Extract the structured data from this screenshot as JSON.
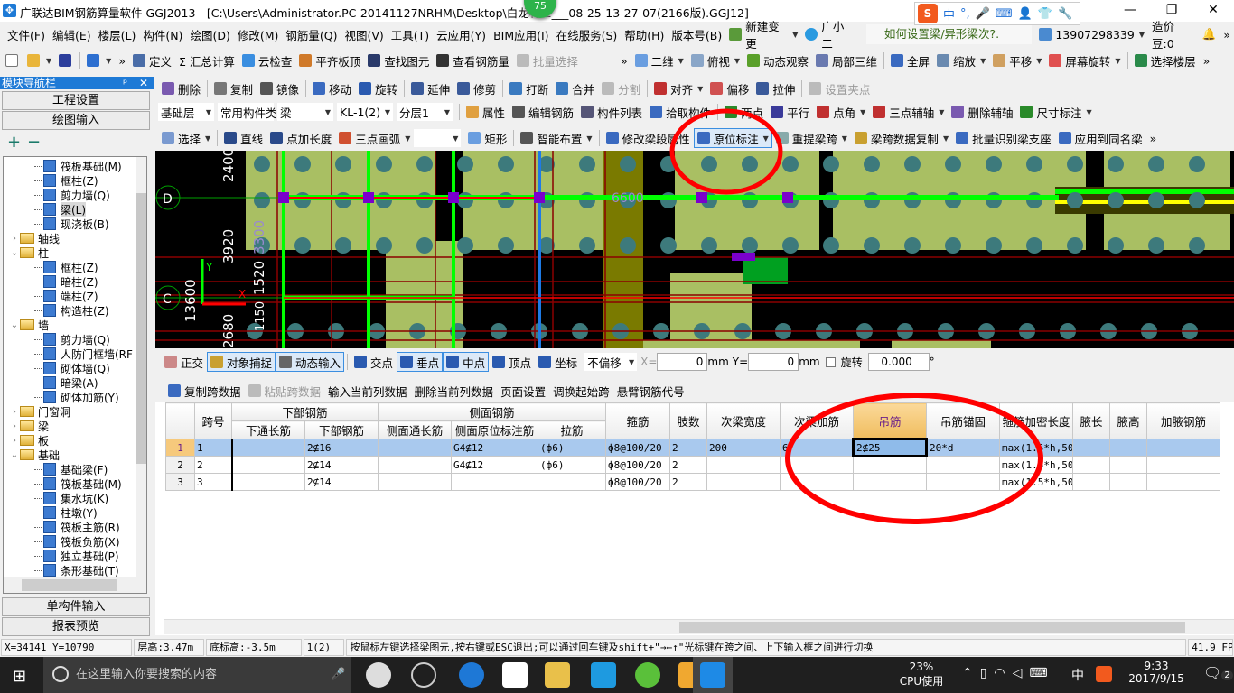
{
  "window": {
    "title": "广联达BIM钢筋算量软件 GGJ2013 - [C:\\Users\\Administrator.PC-20141127NRHM\\Desktop\\白龙村-2___08-25-13-27-07(2166版).GGJ12]",
    "badge": "75",
    "controls": [
      "—",
      "❐",
      "✕"
    ]
  },
  "ime": {
    "logo": "S",
    "items": [
      "中",
      "°,",
      "🎤",
      "⌨",
      "👤",
      "👕",
      "🔧"
    ]
  },
  "menu": {
    "items": [
      "文件(F)",
      "编辑(E)",
      "楼层(L)",
      "构件(N)",
      "绘图(D)",
      "修改(M)",
      "钢筋量(Q)",
      "视图(V)",
      "工具(T)",
      "云应用(Y)",
      "BIM应用(I)",
      "在线服务(S)",
      "帮助(H)",
      "版本号(B)"
    ],
    "new_change": "新建变更",
    "assistant": "广小二",
    "question": "如何设置梁/异形梁次?.",
    "account": "13907298339",
    "beans": "造价豆:0",
    "more": "»"
  },
  "toolbar_main_left": [
    {
      "icon": "new-file",
      "label": "",
      "c": "#fff"
    },
    {
      "icon": "open-folder",
      "label": "",
      "c": "#e9b53a",
      "dd": true
    },
    {
      "icon": "save",
      "label": "",
      "c": "#2c3e9c"
    },
    {
      "sep": true
    },
    {
      "icon": "undo",
      "label": "",
      "c": "#2d6fd0",
      "dd": true
    },
    {
      "label": "»"
    },
    {
      "icon": "define",
      "label": "定义",
      "c": "#4a6da8"
    },
    {
      "icon": "sigma",
      "label": "Σ 汇总计算",
      "noicon": true
    },
    {
      "icon": "cloud-check",
      "label": "云检查",
      "c": "#3a8ee0"
    },
    {
      "icon": "level-slab-top",
      "label": "平齐板顶",
      "c": "#d07a2a"
    },
    {
      "icon": "binoculars",
      "label": "查找图元",
      "c": "#2a3a6a"
    },
    {
      "icon": "glasses",
      "label": "查看钢筋量",
      "c": "#333"
    },
    {
      "icon": "batch-select",
      "label": "批量选择",
      "c": "#bbb",
      "dis": true
    }
  ],
  "toolbar_main_right": [
    {
      "label": "»"
    },
    {
      "icon": "2d-view",
      "label": "二维",
      "c": "#6a9ee0",
      "dd": true
    },
    {
      "icon": "top-view",
      "label": "俯视",
      "c": "#8aa6c8",
      "dd": true
    },
    {
      "icon": "orbit",
      "label": "动态观察",
      "c": "#5aa02a"
    },
    {
      "icon": "local-3d",
      "label": "局部三维",
      "c": "#6a7ab0"
    },
    {
      "sep": true
    },
    {
      "icon": "fullscreen",
      "label": "全屏",
      "c": "#3a6ac0"
    },
    {
      "icon": "zoom",
      "label": "缩放",
      "c": "#6a8ab0",
      "dd": true
    },
    {
      "icon": "pan",
      "label": "平移",
      "c": "#d0a060",
      "dd": true
    },
    {
      "icon": "screen-rotate",
      "label": "屏幕旋转",
      "c": "#e05050",
      "dd": true
    },
    {
      "sep": true
    },
    {
      "icon": "select-floor",
      "label": "选择楼层",
      "c": "#2a8a4a"
    },
    {
      "label": "»"
    }
  ],
  "toolbar_edit": [
    {
      "icon": "delete",
      "label": "删除",
      "c": "#7a5ab0"
    },
    {
      "sep": true
    },
    {
      "icon": "copy",
      "label": "复制",
      "c": "#777"
    },
    {
      "icon": "mirror",
      "label": "镜像",
      "c": "#555"
    },
    {
      "sep": true
    },
    {
      "icon": "move",
      "label": "移动",
      "c": "#3a6ac0"
    },
    {
      "icon": "rotate",
      "label": "旋转",
      "c": "#2a5ab0"
    },
    {
      "sep": true
    },
    {
      "icon": "extend",
      "label": "延伸",
      "c": "#3a5a9a"
    },
    {
      "icon": "trim",
      "label": "修剪",
      "c": "#3a5a9a"
    },
    {
      "sep": true
    },
    {
      "icon": "break",
      "label": "打断",
      "c": "#3a7ac0"
    },
    {
      "icon": "merge",
      "label": "合并",
      "c": "#3a7ac0"
    },
    {
      "icon": "split",
      "label": "分割",
      "c": "#bbb",
      "dis": true
    },
    {
      "sep": true
    },
    {
      "icon": "align",
      "label": "对齐",
      "c": "#c03030",
      "dd": true
    },
    {
      "icon": "offset",
      "label": "偏移",
      "c": "#d05050"
    },
    {
      "icon": "stretch",
      "label": "拉伸",
      "c": "#3a5a9a"
    },
    {
      "sep": true
    },
    {
      "icon": "set-grip",
      "label": "设置夹点",
      "c": "#bbb",
      "dis": true
    }
  ],
  "selectors": [
    {
      "name": "floor-select",
      "value": "基础层",
      "w": 62
    },
    {
      "name": "category-select",
      "value": "常用构件类",
      "w": 62
    },
    {
      "name": "type-select",
      "value": "梁",
      "w": 62
    },
    {
      "name": "component-select",
      "value": "KL-1(2)",
      "w": 62
    },
    {
      "name": "layer-select",
      "value": "分层1",
      "w": 62
    }
  ],
  "toolbar_component": [
    {
      "sep": true
    },
    {
      "icon": "properties",
      "label": "属性",
      "c": "#e0a040"
    },
    {
      "icon": "edit-rebar",
      "label": "编辑钢筋",
      "c": "#555"
    },
    {
      "icon": "component-list",
      "label": "构件列表",
      "c": "#557"
    },
    {
      "icon": "pick-component",
      "label": "拾取构件",
      "c": "#3a6ac0"
    },
    {
      "sep": true
    },
    {
      "icon": "two-point",
      "label": "两点",
      "c": "#2a8a2a"
    },
    {
      "icon": "parallel",
      "label": "平行",
      "c": "#3a3a9a"
    },
    {
      "icon": "point-angle",
      "label": "点角",
      "c": "#c03030",
      "dd": true
    },
    {
      "icon": "three-point-axis",
      "label": "三点辅轴",
      "c": "#c03030",
      "dd": true
    },
    {
      "icon": "delete-axis",
      "label": "删除辅轴",
      "c": "#7a5ab0"
    },
    {
      "icon": "dimension",
      "label": "尺寸标注",
      "c": "#2a8a2a",
      "dd": true
    }
  ],
  "toolbar_draw": [
    {
      "icon": "select-cursor",
      "label": "选择",
      "c": "#7a9ad0",
      "dd": true
    },
    {
      "sep": true
    },
    {
      "icon": "line",
      "label": "直线",
      "c": "#2a4a8a"
    },
    {
      "icon": "point-length",
      "label": "点加长度",
      "c": "#2a4a8a"
    },
    {
      "icon": "arc",
      "label": "三点画弧",
      "c": "#d05030",
      "dd": true
    },
    {
      "emptysel": true
    },
    {
      "icon": "rectangle",
      "label": "矩形",
      "c": "#6a9ee0"
    },
    {
      "sep": true
    },
    {
      "icon": "smart-layout",
      "label": "智能布置",
      "c": "#555",
      "dd": true
    },
    {
      "sep": true
    },
    {
      "icon": "modify-segment",
      "label": "修改梁段属性",
      "c": "#3a6ac0"
    },
    {
      "icon": "in-situ-annotation",
      "label": "原位标注",
      "c": "#3a6ac0",
      "act": true,
      "dd": true
    },
    {
      "icon": "re-extract-span",
      "label": "重提梁跨",
      "c": "#8aa",
      "dd": true
    },
    {
      "icon": "span-data-copy",
      "label": "梁跨数据复制",
      "c": "#c9a030",
      "dd": true
    },
    {
      "icon": "batch-identify-support",
      "label": "批量识别梁支座",
      "c": "#3a6ac0"
    },
    {
      "icon": "apply-same-name",
      "label": "应用到同名梁",
      "c": "#3a6ac0"
    },
    {
      "label": "»"
    }
  ],
  "snap_toolbar": [
    {
      "icon": "orthogonal",
      "label": "正交",
      "c": "#c88"
    },
    {
      "icon": "object-snap",
      "label": "对象捕捉",
      "c": "#c9a030",
      "act": true
    },
    {
      "icon": "dynamic-input",
      "label": "动态输入",
      "c": "#666",
      "act": true
    },
    {
      "sep": true
    },
    {
      "icon": "intersection",
      "label": "交点",
      "c": "#2a5ab0"
    },
    {
      "icon": "perpendicular",
      "label": "垂点",
      "c": "#2a5ab0",
      "act": true
    },
    {
      "icon": "midpoint",
      "label": "中点",
      "c": "#2a5ab0",
      "act": true
    },
    {
      "icon": "vertex",
      "label": "顶点",
      "c": "#2a5ab0"
    },
    {
      "icon": "coordinate",
      "label": "坐标",
      "c": "#2a5ab0"
    }
  ],
  "snap_inputs": {
    "offset": "不偏移",
    "x_label": "X=",
    "x": "0",
    "x_unit": "mm",
    "y_label": "Y=",
    "y": "0",
    "y_unit": "mm",
    "rotate_label": "旋转",
    "rotate": "0.000",
    "deg": "°"
  },
  "grid_toolbar": [
    {
      "icon": "copy-span",
      "label": "复制跨数据",
      "c": "#3a6ac0"
    },
    {
      "icon": "paste-span",
      "label": "粘贴跨数据",
      "c": "#bbb",
      "dis": true
    },
    {
      "label": "输入当前列数据"
    },
    {
      "label": "删除当前列数据"
    },
    {
      "label": "页面设置"
    },
    {
      "label": "调换起始跨"
    },
    {
      "label": "悬臂钢筋代号"
    }
  ],
  "left_panel": {
    "title": "模块导航栏",
    "pin": "ᵖ",
    "close": "✕",
    "btn_project": "工程设置",
    "btn_draw": "绘图输入",
    "expand": "+",
    "collapse": "−",
    "btn_single": "单构件输入",
    "btn_report": "报表预览"
  },
  "tree": [
    {
      "l": 2,
      "t": "筏板基础(M)"
    },
    {
      "l": 2,
      "t": "框柱(Z)"
    },
    {
      "l": 2,
      "t": "剪力墙(Q)"
    },
    {
      "l": 2,
      "t": "梁(L)",
      "sel": true
    },
    {
      "l": 2,
      "t": "现浇板(B)"
    },
    {
      "l": 1,
      "t": "轴线",
      "f": "c"
    },
    {
      "l": 1,
      "t": "柱",
      "f": "o"
    },
    {
      "l": 2,
      "t": "框柱(Z)"
    },
    {
      "l": 2,
      "t": "暗柱(Z)"
    },
    {
      "l": 2,
      "t": "端柱(Z)"
    },
    {
      "l": 2,
      "t": "构造柱(Z)"
    },
    {
      "l": 1,
      "t": "墙",
      "f": "o"
    },
    {
      "l": 2,
      "t": "剪力墙(Q)"
    },
    {
      "l": 2,
      "t": "人防门框墙(RF"
    },
    {
      "l": 2,
      "t": "砌体墙(Q)"
    },
    {
      "l": 2,
      "t": "暗梁(A)"
    },
    {
      "l": 2,
      "t": "砌体加筋(Y)"
    },
    {
      "l": 1,
      "t": "门窗洞",
      "f": "c"
    },
    {
      "l": 1,
      "t": "梁",
      "f": "c"
    },
    {
      "l": 1,
      "t": "板",
      "f": "c"
    },
    {
      "l": 1,
      "t": "基础",
      "f": "o"
    },
    {
      "l": 2,
      "t": "基础梁(F)"
    },
    {
      "l": 2,
      "t": "筏板基础(M)"
    },
    {
      "l": 2,
      "t": "集水坑(K)"
    },
    {
      "l": 2,
      "t": "柱墩(Y)"
    },
    {
      "l": 2,
      "t": "筏板主筋(R)"
    },
    {
      "l": 2,
      "t": "筏板负筋(X)"
    },
    {
      "l": 2,
      "t": "独立基础(P)"
    },
    {
      "l": 2,
      "t": "条形基础(T)"
    }
  ],
  "canvas": {
    "labels": {
      "axis_d": "D",
      "axis_c": "C",
      "dim_2400": "2400",
      "dim_3920": "3920",
      "dim_13600": "13600",
      "dim_2680": "2680",
      "dim_3300": "3300",
      "dim_1520": "1520",
      "dim_1150": "1150",
      "dim_6600": "6600",
      "ucs_y": "Y",
      "ucs_x": "X"
    }
  },
  "table": {
    "group_headers": {
      "lower": "下部钢筋",
      "side": "侧面钢筋"
    },
    "headers": [
      "跨号",
      "下通长筋",
      "下部钢筋",
      "侧面通长筋",
      "侧面原位标注筋",
      "拉筋",
      "箍筋",
      "肢数",
      "次梁宽度",
      "次梁加筋",
      "吊筋",
      "吊筋锚固",
      "箍筋加密长度",
      "腋长",
      "腋高",
      "加腋钢筋"
    ],
    "rows": [
      {
        "n": "1",
        "cells": [
          "1",
          "",
          "2⊈16",
          "",
          "G4⊈12",
          "(ф6)",
          "ф8@100/20",
          "2",
          "200",
          "6",
          "2⊈25",
          "20*d",
          "max(1.5*h,50",
          "",
          "",
          ""
        ]
      },
      {
        "n": "2",
        "cells": [
          "2",
          "",
          "2⊈14",
          "",
          "G4⊈12",
          "(ф6)",
          "ф8@100/20",
          "2",
          "",
          "",
          "",
          "",
          "max(1.5*h,50",
          "",
          "",
          ""
        ]
      },
      {
        "n": "3",
        "cells": [
          "3",
          "",
          "2⊈14",
          "",
          "",
          "",
          "ф8@100/20",
          "2",
          "",
          "",
          "",
          "",
          "max(1.5*h,50",
          "",
          "",
          ""
        ]
      }
    ],
    "selected_row": 1,
    "active_column": "吊筋"
  },
  "status": {
    "coords": "X=34141 Y=10790",
    "floor_height": "层高:3.47m",
    "bottom_elev": "底标高:-3.5m",
    "span": "1(2)",
    "hint": "按鼠标左键选择梁图元,按右键或ESC退出;可以通过回车键及shift+\"→←↑\"光标键在跨之间、上下输入框之间进行切换",
    "fps": "41.9 FPS"
  },
  "taskbar": {
    "search_placeholder": "在这里输入你要搜索的内容",
    "cpu_pct": "23%",
    "cpu_label": "CPU使用",
    "ime": "中",
    "time": "9:33",
    "date": "2017/9/15",
    "notifications": "2"
  },
  "colors": {
    "accent": "#1e7ad6",
    "annotation_red": "#ff0000",
    "selected_row": "#a9c9ee",
    "active_header": "#f0bd5e"
  }
}
